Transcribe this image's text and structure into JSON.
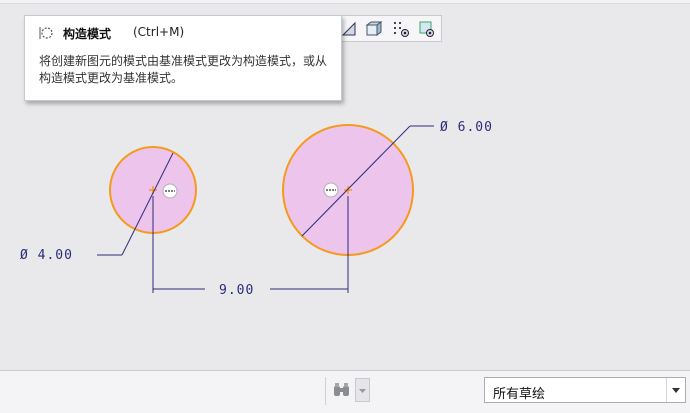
{
  "tooltip": {
    "title": "构造模式",
    "shortcut": "(Ctrl+M)",
    "description": "将创建新图元的模式由基准模式更改为构造模式，或从构造模式更改为基准模式。"
  },
  "toolbar": {
    "icons": [
      "plane-display-icon",
      "solid-display-icon",
      "datum-points-icon",
      "view-manager-icon"
    ]
  },
  "sketch": {
    "small_circle_dim": "Ø 4.00",
    "large_circle_dim": "Ø 6.00",
    "distance_dim": "9.00"
  },
  "statusbar": {
    "filter_value": "所有草绘",
    "icons": [
      "binoculars-icon",
      "chevron-down-icon"
    ]
  },
  "colors": {
    "canvas": "#e9e9ec",
    "circle_fill": "#ecc4ec",
    "circle_stroke": "#f59a1c",
    "dimension": "#2b2b7a"
  }
}
